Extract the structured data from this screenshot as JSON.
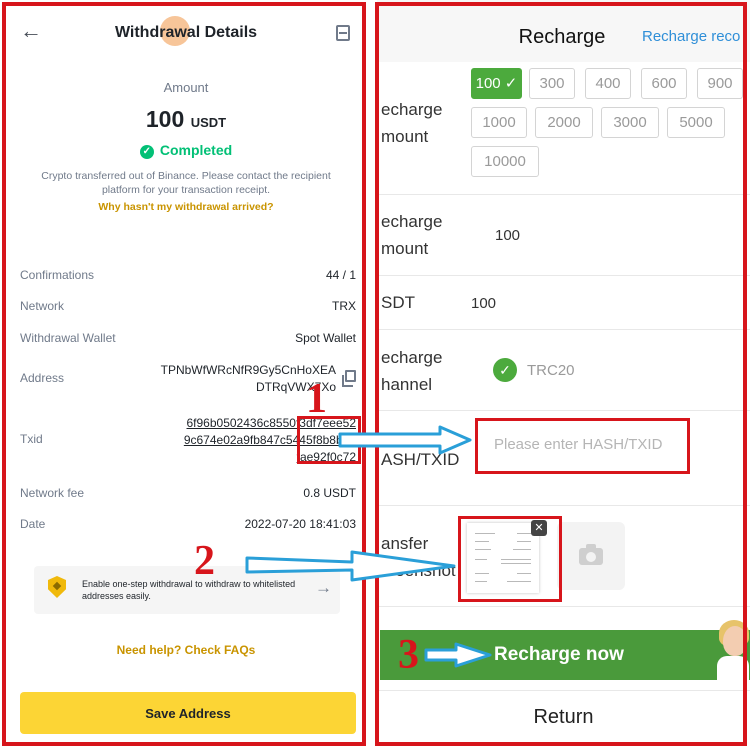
{
  "left": {
    "header": {
      "title": "Withdrawal Details"
    },
    "amount": {
      "label": "Amount",
      "value": "100",
      "unit": "USDT"
    },
    "status": "Completed",
    "notice": "Crypto transferred out of Binance. Please contact the recipient platform for your transaction receipt.",
    "why_link": "Why hasn't my withdrawal arrived?",
    "details": [
      {
        "key": "Confirmations",
        "value": "44 / 1"
      },
      {
        "key": "Network",
        "value": "TRX"
      },
      {
        "key": "Withdrawal Wallet",
        "value": "Spot Wallet"
      },
      {
        "key": "Address",
        "value_line1": "TPNbWfWRcNfR9Gy5CnHoXEA",
        "value_line2": "DTRqVWX7Xo"
      },
      {
        "key": "Txid",
        "value_line1": "6f96b0502436c8550f3df7eee52",
        "value_line2": "9c674e02a9fb847c5445f8b8b05",
        "value_line3": "fae92f0c72"
      },
      {
        "key": "Network fee",
        "value": "0.8 USDT"
      },
      {
        "key": "Date",
        "value": "2022-07-20 18:41:03"
      }
    ],
    "whitelist": "Enable one-step withdrawal to withdraw to whitelisted addresses easily.",
    "faq_link": "Need help? Check FAQs",
    "save_button": "Save Address"
  },
  "right": {
    "title": "Recharge",
    "record_link": "Recharge reco",
    "recharge_amount_label_1": "echarge",
    "recharge_amount_label_2": "mount",
    "chips": [
      "100",
      "300",
      "400",
      "600",
      "900",
      "1000",
      "2000",
      "3000",
      "5000",
      "10000"
    ],
    "selected_chip": "100",
    "amount_row_label_1": "echarge",
    "amount_row_label_2": "mount",
    "amount_value": "100",
    "usdt_label": "SDT",
    "usdt_value": "100",
    "channel_label_1": "echarge",
    "channel_label_2": "hannel",
    "channel_value": "TRC20",
    "hash_label": "ASH/TXID",
    "hash_placeholder": "Please enter HASH/TXID",
    "screenshot_label_1": "ansfer",
    "screenshot_label_2": "creenshot",
    "recharge_button": "Recharge now",
    "return_button": "Return"
  },
  "annotations": {
    "step1": "1",
    "step2": "2",
    "step3": "3"
  },
  "colors": {
    "annotation_red": "#d7151b",
    "arrow_blue": "#2a9fd8",
    "binance_yellow": "#fcd535",
    "success_green": "#02c076",
    "recharge_green": "#4a9a3b",
    "link_gold": "#c99400"
  }
}
